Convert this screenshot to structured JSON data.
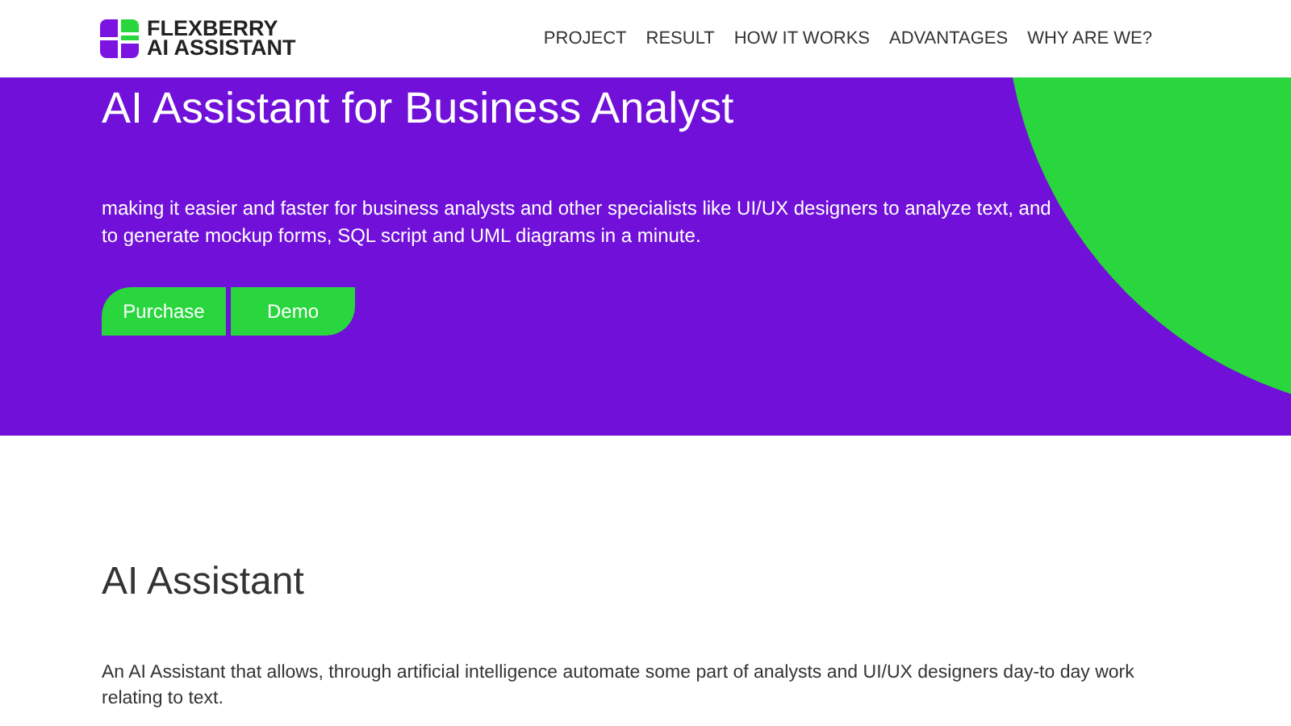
{
  "logo": {
    "line_1": "FLEXBERRY",
    "line_2": "AI ASSISTANT"
  },
  "nav": [
    "PROJECT",
    "RESULT",
    "HOW IT WORKS",
    "ADVANTAGES",
    "WHY ARE WE?"
  ],
  "hero": {
    "title": "AI Assistant for Business Analyst",
    "description": "making it easier and faster for business analysts and other specialists like UI/UX designers to analyze text, and to generate mockup forms, SQL script and UML diagrams in a minute.",
    "buttons": [
      "Purchase",
      "Demo"
    ]
  },
  "section": {
    "title": "AI Assistant",
    "text": "An AI Assistant that allows, through artificial intelligence automate some part of analysts and UI/UX designers day-to day work relating to text."
  }
}
